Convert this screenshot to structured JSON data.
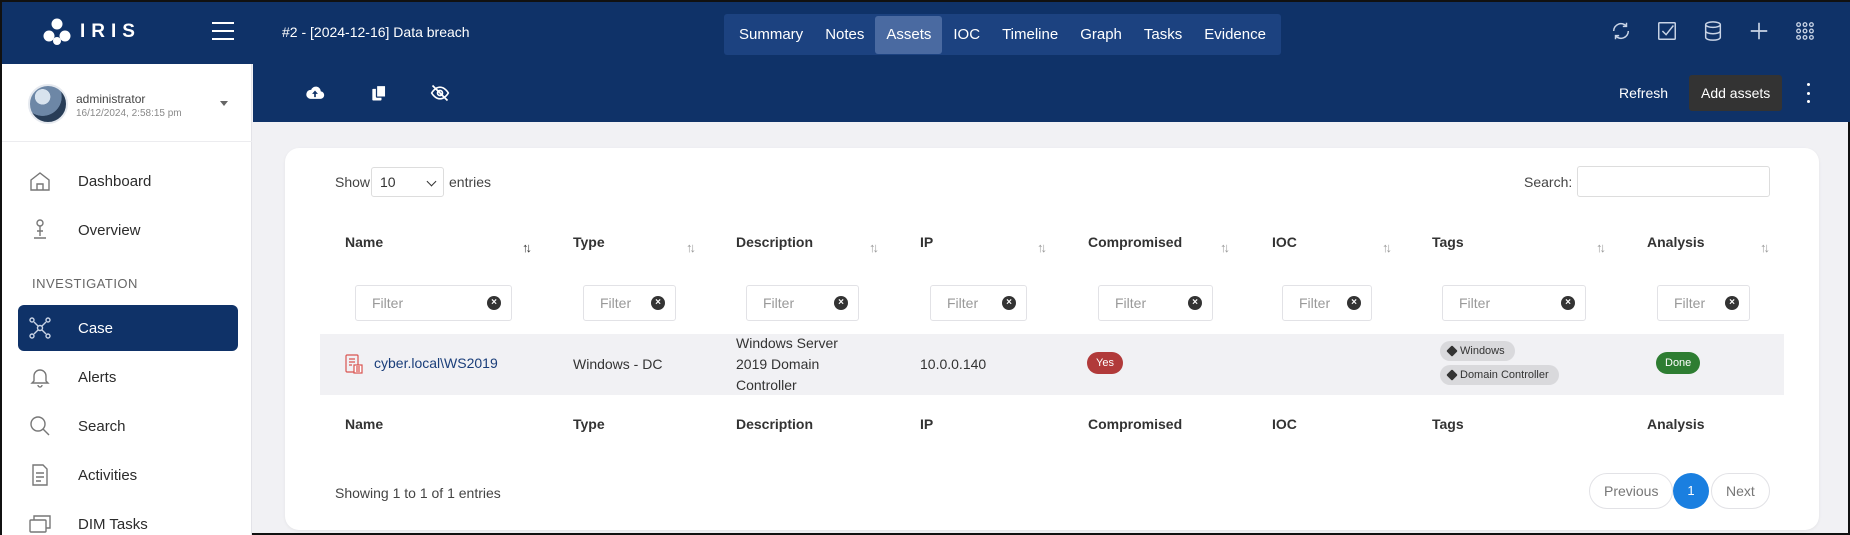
{
  "app": {
    "name": "IRIS",
    "case_title": "#2 - [2024-12-16] Data breach"
  },
  "nav": {
    "tabs": [
      "Summary",
      "Notes",
      "Assets",
      "IOC",
      "Timeline",
      "Graph",
      "Tasks",
      "Evidence"
    ],
    "active": "Assets"
  },
  "top_icons": [
    "refresh-icon",
    "checkbox-icon",
    "database-icon",
    "plus-icon",
    "grid-icon"
  ],
  "user": {
    "name": "administrator",
    "last_login": "16/12/2024, 2:58:15 pm"
  },
  "sidebar": {
    "items": [
      {
        "label": "Dashboard",
        "icon": "home-icon"
      },
      {
        "label": "Overview",
        "icon": "overview-icon"
      },
      {
        "label": "Case",
        "icon": "network-icon",
        "active": true
      },
      {
        "label": "Alerts",
        "icon": "bell-icon"
      },
      {
        "label": "Search",
        "icon": "search-icon"
      },
      {
        "label": "Activities",
        "icon": "document-icon"
      },
      {
        "label": "DIM Tasks",
        "icon": "tasks-icon"
      }
    ],
    "section_label": "INVESTIGATION"
  },
  "toolbar": {
    "icons": [
      "cloud-upload-icon",
      "copy-icon",
      "eye-slash-icon"
    ],
    "refresh_label": "Refresh",
    "add_label": "Add assets"
  },
  "table": {
    "show_label": "Show",
    "page_size": "10",
    "entries_label": "entries",
    "search_label": "Search:",
    "filter_placeholder": "Filter",
    "columns": [
      "Name",
      "Type",
      "Description",
      "IP",
      "Compromised",
      "IOC",
      "Tags",
      "Analysis"
    ],
    "rows": [
      {
        "name": "cyber.local\\WS2019",
        "type": "Windows - DC",
        "description": [
          "Windows Server",
          "2019 Domain",
          "Controller"
        ],
        "ip": "10.0.0.140",
        "compromised": "Yes",
        "ioc": "",
        "tags": [
          "Windows",
          "Domain Controller"
        ],
        "analysis": "Done"
      }
    ],
    "info": "Showing 1 to 1 of 1 entries",
    "pagination": {
      "previous": "Previous",
      "current": "1",
      "next": "Next"
    }
  },
  "colors": {
    "primary": "#0f3268",
    "compromised": "#b13a3a",
    "done": "#2e7d32",
    "page_active": "#1a7fe0"
  }
}
